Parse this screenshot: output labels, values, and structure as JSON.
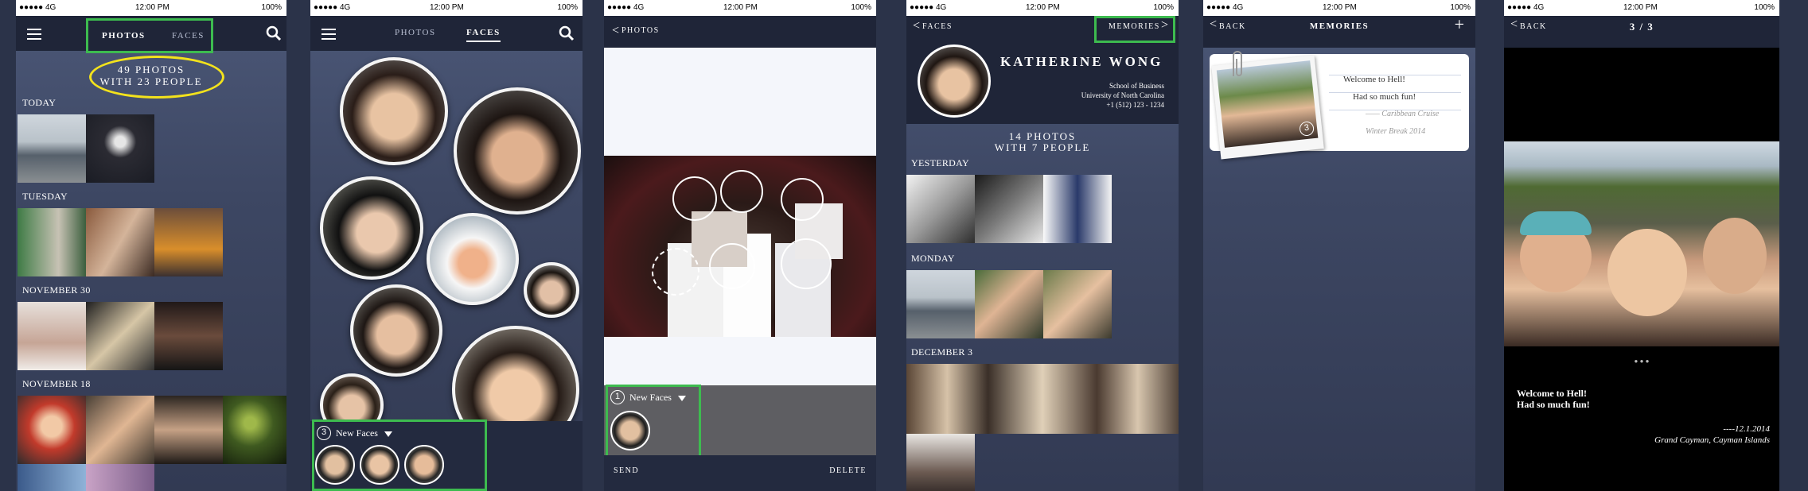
{
  "status": {
    "signal": "●●●●● 4G",
    "time": "12:00 PM",
    "battery": "100%"
  },
  "s1": {
    "tab_photos": "PHOTOS",
    "tab_faces": "FACES",
    "summary_line1": "49 PHOTOS",
    "summary_line2": "WITH 23 PEOPLE",
    "sections": [
      "TODAY",
      "TUESDAY",
      "NOVEMBER 30",
      "NOVEMBER 18"
    ]
  },
  "s2": {
    "tab_photos": "PHOTOS",
    "tab_faces": "FACES",
    "new_faces_count": "3",
    "new_faces_label": "New Faces"
  },
  "s3": {
    "back": "PHOTOS",
    "new_faces_count": "1",
    "new_faces_label": "New Faces",
    "send": "SEND",
    "delete": "DELETE"
  },
  "s4": {
    "back": "FACES",
    "memories": "MEMORIES",
    "name": "KATHERINE WONG",
    "school": "School of Business",
    "university": "University of North Carolina",
    "phone": "+1 (512) 123 - 1234",
    "summary_line1": "14 PHOTOS",
    "summary_line2": "WITH 7 PEOPLE",
    "sections": [
      "YESTERDAY",
      "MONDAY",
      "DECEMBER 3"
    ]
  },
  "s5": {
    "back": "BACK",
    "title": "MEMORIES",
    "add": "+",
    "card_badge": "3",
    "note_line1": "Welcome to Hell!",
    "note_line2": "Had so much fun!",
    "note_line3": "—— Caribbean Cruise",
    "note_line4": "Winter Break 2014"
  },
  "s6": {
    "back": "BACK",
    "title": "3 / 3",
    "caption_line1": "Welcome to Hell!",
    "caption_line2": "Had so much fun!",
    "caption_date": "----12.1.2014",
    "caption_place": "Grand Cayman, Cayman Islands"
  },
  "colors": {
    "green_highlight": "#3dbb4f",
    "yellow_highlight": "#f3e21c",
    "nav_bg": "#1f2538",
    "screen_bg": "#3d4763"
  }
}
